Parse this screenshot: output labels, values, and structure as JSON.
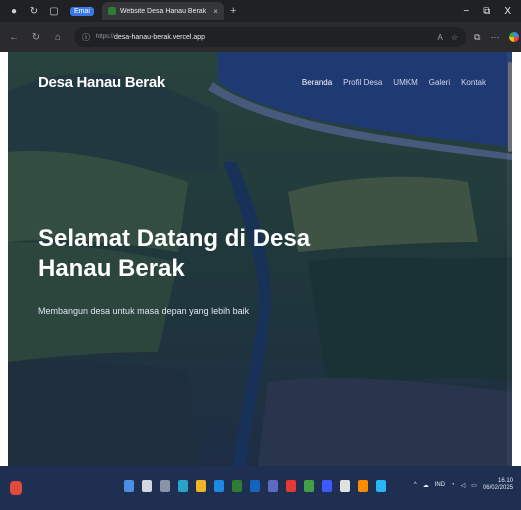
{
  "browser": {
    "tab_chip": "Emai",
    "tab_title": "Website Desa Hanau Berak",
    "tab_close": "×",
    "new_tab": "+",
    "window_controls": [
      "−",
      "⧉",
      "X"
    ],
    "url_scheme": "https://",
    "url_host": "desa-hanau-berak.vercel.app"
  },
  "site": {
    "brand": "Desa Hanau Berak",
    "nav": [
      "Beranda",
      "Profil Desa",
      "UMKM",
      "Galeri",
      "Kontak"
    ],
    "active_nav": "Beranda",
    "hero_title": "Selamat Datang di Desa Hanau Berak",
    "hero_subtitle": "Membangun desa untuk masa depan yang lebih baik"
  },
  "taskbar": {
    "lang": "IND",
    "time": "16.10",
    "date": "06/02/2025"
  },
  "colors": {
    "overlay": "#0b1a4a",
    "taskbar": "#1f2f52"
  }
}
